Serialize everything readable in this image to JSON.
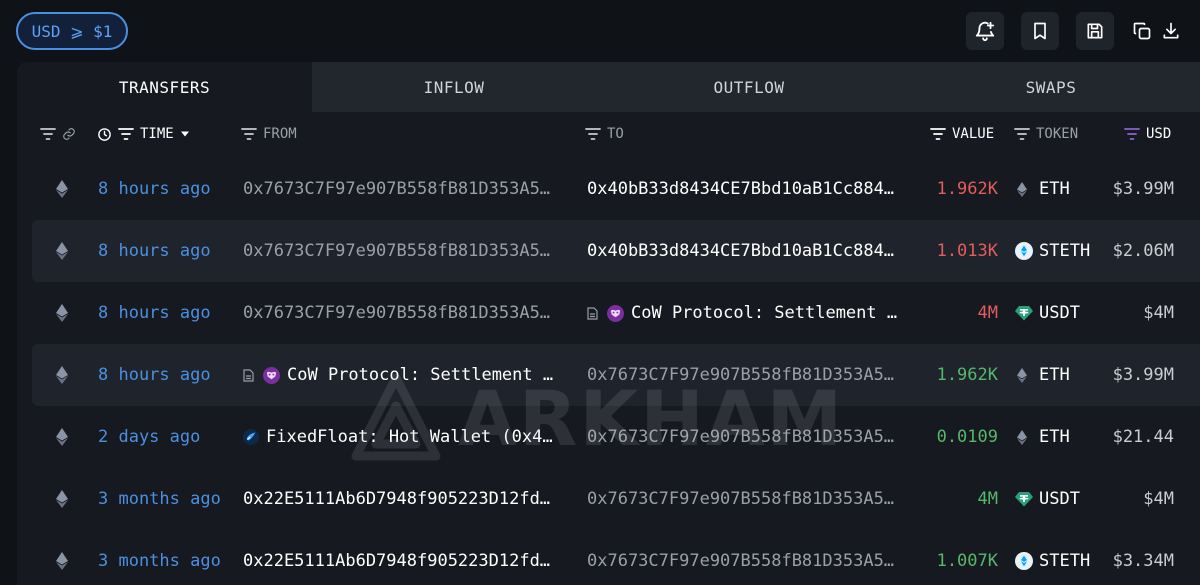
{
  "filter": {
    "label": "USD ⩾ $1"
  },
  "toolbar": {
    "icons": [
      "bell-plus-icon",
      "bookmark-icon",
      "save-icon",
      "copy-icon",
      "download-icon"
    ]
  },
  "tabs": [
    {
      "label": "TRANSFERS",
      "active": true
    },
    {
      "label": "INFLOW",
      "active": false
    },
    {
      "label": "OUTFLOW",
      "active": false
    },
    {
      "label": "SWAPS",
      "active": false
    }
  ],
  "columns": {
    "time": "TIME",
    "from": "FROM",
    "to": "TO",
    "value": "VALUE",
    "token": "TOKEN",
    "usd": "USD"
  },
  "rows": [
    {
      "time": "8 hours ago",
      "from": "0x7673C7F97e907B558fB81D353A5…",
      "to": "0x40bB33d8434CE7Bbd10aB1Cc884…",
      "value": "1.962K",
      "token": "ETH",
      "usd": "$3.99M"
    },
    {
      "time": "8 hours ago",
      "from": "0x7673C7F97e907B558fB81D353A5…",
      "to": "0x40bB33d8434CE7Bbd10aB1Cc884…",
      "value": "1.013K",
      "token": "STETH",
      "usd": "$2.06M"
    },
    {
      "time": "8 hours ago",
      "from": "0x7673C7F97e907B558fB81D353A5…",
      "to": "CoW Protocol: Settlement …",
      "value": "4M",
      "token": "USDT",
      "usd": "$4M"
    },
    {
      "time": "8 hours ago",
      "from": "CoW Protocol: Settlement …",
      "to": "0x7673C7F97e907B558fB81D353A5…",
      "value": "1.962K",
      "token": "ETH",
      "usd": "$3.99M"
    },
    {
      "time": "2 days ago",
      "from": "FixedFloat: Hot Wallet (0x4…",
      "to": "0x7673C7F97e907B558fB81D353A5…",
      "value": "0.0109",
      "token": "ETH",
      "usd": "$21.44"
    },
    {
      "time": "3 months ago",
      "from": "0x22E5111Ab6D7948f905223D12fd…",
      "to": "0x7673C7F97e907B558fB81D353A5…",
      "value": "4M",
      "token": "USDT",
      "usd": "$4M"
    },
    {
      "time": "3 months ago",
      "from": "0x22E5111Ab6D7948f905223D12fd…",
      "to": "0x7673C7F97e907B558fB81D353A5…",
      "value": "1.007K",
      "token": "STETH",
      "usd": "$3.34M"
    }
  ],
  "watermark": {
    "text": "ARKHAM"
  },
  "colors": {
    "accent": "#4a90e2",
    "negative": "#e35d5d",
    "positive": "#55b86a",
    "usdt": "#26a17b",
    "steth": "#00a3ff",
    "cow": "#7a2ea0"
  }
}
